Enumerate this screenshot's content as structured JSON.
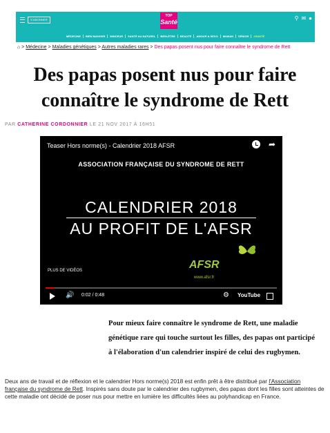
{
  "header": {
    "subscribe_label": "S'ABONNER",
    "logo_top": "TOP",
    "logo_main": "Santé",
    "icons": [
      "search-icon",
      "mail-icon",
      "account-icon"
    ],
    "nav": [
      "MÉDECINE",
      "BIEN MANGER",
      "MINCEUR",
      "SANTÉ AU NATUREL",
      "BIEN-ÊTRE",
      "BEAUTÉ",
      "AMOUR & SEXO",
      "MAMAN",
      "SÉNIOR",
      "#SANTÉ"
    ],
    "accent_color": "#17b6b7",
    "brand_color": "#e6007e"
  },
  "breadcrumb": {
    "items": [
      "Médecine",
      "Maladies génétiques",
      "Autres maladies rares"
    ],
    "current": "Des papas posent nus pour faire connaître le syndrome de Rett"
  },
  "article": {
    "title": "Des papas posent nus pour faire connaître le syndrome de Rett",
    "byline_prefix": "PAR",
    "author": "CATHERINE CORDONNIER",
    "date": "LE 21 NOV 2017 À 16H51",
    "lead": "Pour mieux faire connaître le syndrome de Rett, une maladie génétique rare qui touche surtout les filles, des papas ont participé à l'élaboration d'un calendrier inspiré de celui des rugbymen.",
    "body_part1": "Deux ans de travail et de réflexion et le calendrier Hors norme(s) 2018 est enfin prêt à être distribué par ",
    "body_link": "l'Association française du syndrome de Rett",
    "body_part2": ". Inspirés sans doute par le calendrier des rugbymen, des papas dont les filles sont atteintes de cette maladie ont décidé de poser nus pour mettre en lumière les difficultés liées au polyhandicap en France."
  },
  "video": {
    "title": "Teaser Hors norme(s) - Calendrier 2018 AFSR",
    "association": "ASSOCIATION FRANÇAISE DU SYNDROME DE RETT",
    "line1": "CALENDRIER 2018",
    "line2": "AU PROFIT DE L'AFSR",
    "more_videos": "PLUS DE VIDÉOS",
    "afsr_logo": "AFSR",
    "afsr_url": "www.afsr.fr",
    "time": "0:02 / 0:48",
    "progress": 0.04,
    "youtube": "YouTube"
  }
}
